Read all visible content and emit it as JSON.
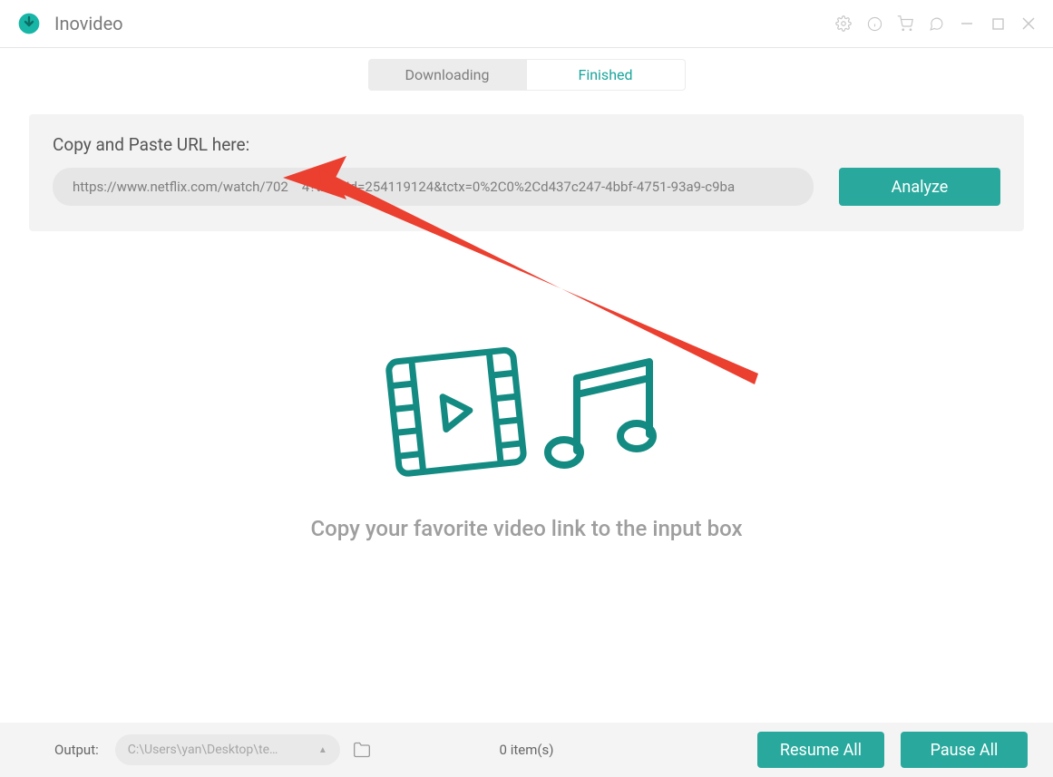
{
  "app": {
    "title": "Inovideo"
  },
  "tabs": {
    "downloading": "Downloading",
    "finished": "Finished"
  },
  "url_card": {
    "label": "Copy and Paste URL here:",
    "input_value": "https://www.netflix.com/watch/702    4?trackId=254119124&tctx=0%2C0%2Cd437c247-4bbf-4751-93a9-c9ba",
    "analyze_label": "Analyze"
  },
  "empty_state": {
    "message": "Copy your favorite video link to the input box"
  },
  "bottom": {
    "output_label": "Output:",
    "output_path": "C:\\Users\\yan\\Desktop\\te…",
    "items_count": "0 item(s)",
    "resume_label": "Resume All",
    "pause_label": "Pause All"
  },
  "colors": {
    "accent": "#29a99d",
    "arrow": "#eb3f30"
  }
}
